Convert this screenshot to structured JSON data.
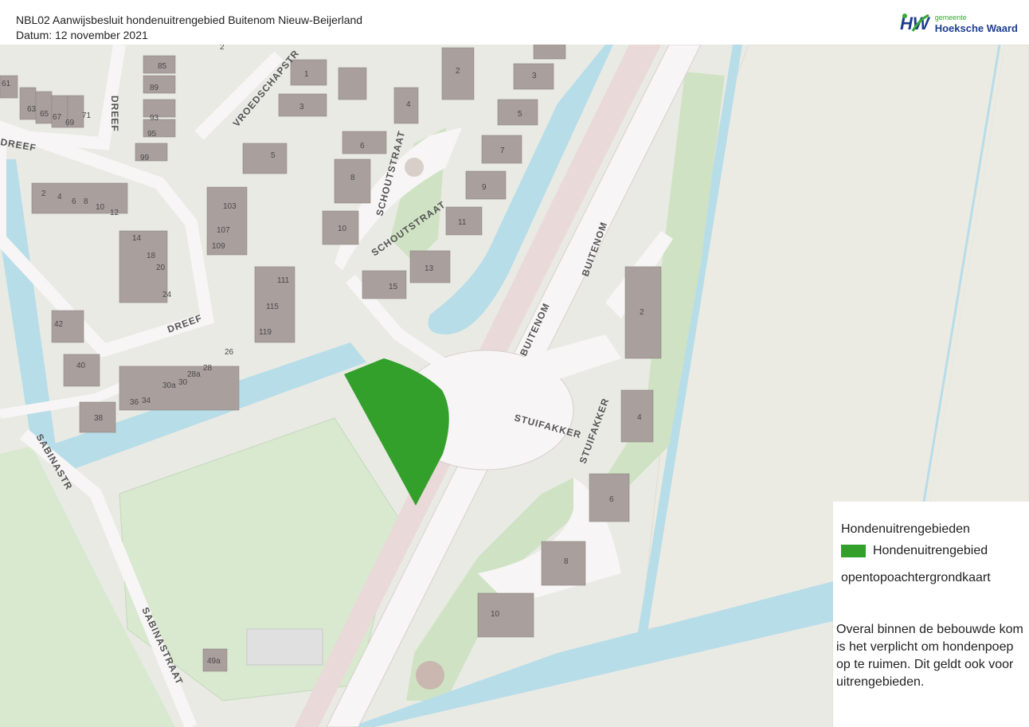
{
  "header": {
    "title": "NBL02 Aanwijsbesluit hondenuitrengebied Buitenom Nieuw-Beijerland",
    "date": "Datum: 12 november 2021"
  },
  "logo": {
    "mark": "HW",
    "small": "gemeente",
    "name": "Hoeksche Waard",
    "colors": {
      "green": "#39a935",
      "blue": "#1d3d8f"
    }
  },
  "legend": {
    "heading": "Hondenuitrengebieden",
    "item_label": "Hondenuitrengebied",
    "item_color": "#34a02c",
    "basemap_label": "opentopoachtergrondkaart",
    "note": "Overal binnen de bebouwde kom is het verplicht om hondenpoep op te ruimen. Dit geldt ook voor uitrengebieden."
  },
  "map": {
    "colors": {
      "land": "#e9eae4",
      "road": "#f7f5f5",
      "road_edge": "#d9cfcf",
      "water": "#b7dde9",
      "grass": "#cfe3c4",
      "field": "#ecebe3",
      "building": "#a99f9c",
      "dog_area": "#34a02c"
    },
    "streets": {
      "dreef_1": "DREEF",
      "dreef_2": "DREEF",
      "dreef_3": "DREEF",
      "vroedschapstr": "VROEDSCHAPSTR",
      "schoutstraat_1": "SCHOUTSTRAAT",
      "schoutstraat_2": "SCHOUTSTRAAT",
      "buitenom_1": "BUITENOM",
      "buitenom_2": "BUITENOM",
      "stuifakker_1": "STUIFAKKER",
      "stuifakker_2": "STUIFAKKER",
      "sabinastr": "SABINASTR",
      "sabinastraat": "SABINASTRAAT"
    },
    "house_numbers": {
      "h61": "61",
      "h63": "63",
      "h65": "65",
      "h67": "67",
      "h69": "69",
      "h71": "71",
      "h85": "85",
      "h89": "89",
      "h93": "93",
      "h95": "95",
      "h99": "99",
      "h1": "1",
      "h3": "3",
      "h5": "5",
      "h6": "6",
      "h8": "8",
      "h10": "10",
      "h4": "4",
      "h2": "2",
      "h103": "103",
      "h107": "107",
      "h109": "109",
      "h111": "111",
      "h115": "115",
      "h119": "119",
      "h13": "13",
      "h15": "15",
      "e3": "3",
      "e5": "5",
      "e7": "7",
      "e9": "9",
      "e11": "11",
      "e2top": "2",
      "d2": "2",
      "d4": "4",
      "d6": "6",
      "d8": "8",
      "d10": "10",
      "d12": "12",
      "d14": "14",
      "d18": "18",
      "d20": "20",
      "d24": "24",
      "d42": "42",
      "d40": "40",
      "d38": "38",
      "d36": "36",
      "d34": "34",
      "d30a": "30a",
      "d30": "30",
      "d28a": "28a",
      "d28": "28",
      "d26": "26",
      "s2": "2",
      "s4": "4",
      "s6": "6",
      "s8": "8",
      "s10": "10",
      "h49a": "49a"
    }
  }
}
